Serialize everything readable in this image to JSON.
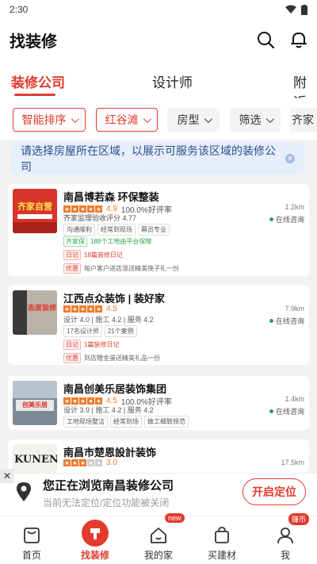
{
  "status": {
    "time": "2:30"
  },
  "header": {
    "title": "找装修"
  },
  "tabs": [
    {
      "label": "装修公司"
    },
    {
      "label": "设计师"
    },
    {
      "label": "附近"
    }
  ],
  "filters": [
    {
      "label": "智能排序"
    },
    {
      "label": "红谷滩"
    },
    {
      "label": "房型"
    },
    {
      "label": "筛选"
    },
    {
      "label": "齐家"
    }
  ],
  "notice": {
    "text": "请选择房屋所在区域，以展示可服务该区域的装修公司"
  },
  "companies": [
    {
      "name": "南昌博若森 环保整装",
      "score": "4.9",
      "praise": "100.0%好评率",
      "line1": "齐家监理验收评分 4.77",
      "tags": [
        "沟通顺利",
        "经常到现场",
        "幕员专业"
      ],
      "badge_label": "齐家保",
      "badge_text": "188个工地由平台保障",
      "diary_label": "日记",
      "diary_text": "18篇装修日记",
      "promo_label": "优惠",
      "promo_text": "每户客户进店混送精美筷子礼一份",
      "distance": "1.2km",
      "online": "在线咨询",
      "thumb_text": "齐家自营",
      "stars": 5
    },
    {
      "name": "江西点众装饰 | 装好家",
      "score": "4.5",
      "line1": "设计 4.0 | 施工 4.2 | 服务 4.2",
      "tags": [
        "17名设计师",
        "21个案例"
      ],
      "diary_label": "日记",
      "diary_text": "1篇装修日记",
      "promo_label": "优惠",
      "promo_text": "到店赠金蛋送精美礼品一份",
      "distance": "7.9km",
      "online": "在线咨询",
      "thumb_text": "态度装修",
      "stars": 5
    },
    {
      "name": "南昌创美乐居装饰集团",
      "score": "4.5",
      "praise": "100.0%好评率",
      "line1": "设计 3.9 | 施工 4.2 | 服务 4.2",
      "tags": [
        "工地现场整洁",
        "经常到场",
        "做工细致规范"
      ],
      "distance": "1.4km",
      "online": "在线咨询",
      "thumb_text": "创美乐居",
      "stars": 5
    },
    {
      "name": "南昌市楚恩設計装饰",
      "score": "3.0",
      "distance": "17.5km",
      "thumb_text": "KUNEN",
      "stars": 3
    }
  ],
  "location_bar": {
    "title": "您正在浏览南昌装修公司",
    "subtitle": "当前无法定位/定位功能被关闭",
    "button": "开启定位",
    "close": "✕"
  },
  "nav": {
    "items": [
      {
        "label": "首页"
      },
      {
        "label": "找装修"
      },
      {
        "label": "我的家",
        "badge": "new"
      },
      {
        "label": "买建材"
      },
      {
        "label": "我",
        "badge": "赚币"
      }
    ]
  },
  "colors": {
    "accent": "#e23b2e",
    "star": "#f07b2b",
    "notice_bg": "#e6eefc"
  }
}
